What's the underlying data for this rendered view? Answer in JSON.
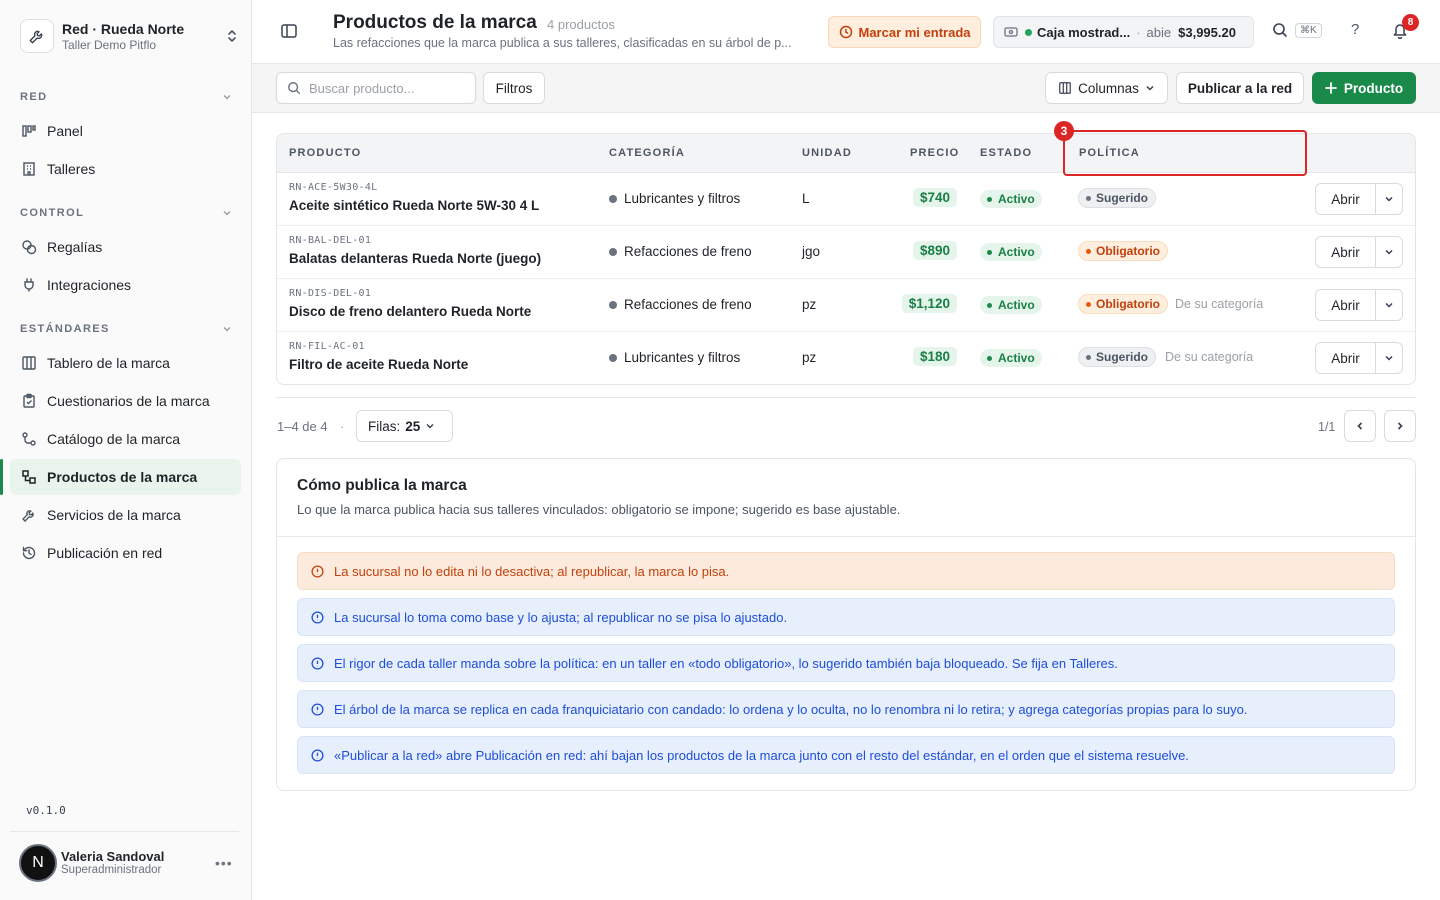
{
  "sidebar": {
    "org_name": "Red · Rueda Norte",
    "org_sub": "Taller Demo Pitflo",
    "sections": [
      {
        "label": "RED",
        "items": [
          {
            "label": "Panel"
          },
          {
            "label": "Talleres"
          }
        ]
      },
      {
        "label": "CONTROL",
        "items": [
          {
            "label": "Regalías"
          },
          {
            "label": "Integraciones"
          }
        ]
      },
      {
        "label": "ESTÁNDARES",
        "items": [
          {
            "label": "Tablero de la marca"
          },
          {
            "label": "Cuestionarios de la marca"
          },
          {
            "label": "Catálogo de la marca"
          },
          {
            "label": "Productos de la marca"
          },
          {
            "label": "Servicios de la marca"
          },
          {
            "label": "Publicación en red"
          }
        ]
      }
    ],
    "version": "v0.1.0",
    "user": {
      "initial": "N",
      "name": "Valeria Sandoval",
      "role": "Superadministrador"
    }
  },
  "header": {
    "title": "Productos de la marca",
    "count": "4 productos",
    "subtitle": "Las refacciones que la marca publica a sus talleres, clasificadas en su árbol de p...",
    "entrada_label": "Marcar mi entrada",
    "caja_name": "Caja mostrad...",
    "caja_sep": "·",
    "caja_status": "abie",
    "caja_amount": "$3,995.20",
    "kbd": "⌘K",
    "help": "?",
    "notifications": "8"
  },
  "toolbar": {
    "search_placeholder": "Buscar producto...",
    "filters_label": "Filtros",
    "columns_label": "Columnas",
    "publish_label": "Publicar a la red",
    "add_label": "Producto"
  },
  "table": {
    "columns": [
      "PRODUCTO",
      "CATEGORÍA",
      "UNIDAD",
      "PRECIO",
      "ESTADO",
      "POLÍTICA"
    ],
    "open_label": "Abrir",
    "rows": [
      {
        "sku": "RN-ACE-5W30-4L",
        "name": "Aceite sintético Rueda Norte 5W-30 4 L",
        "category": "Lubricantes y filtros",
        "unit": "L",
        "price": "$740",
        "status": "Activo",
        "policy": "Sugerido",
        "policy_type": "sug",
        "note": ""
      },
      {
        "sku": "RN-BAL-DEL-01",
        "name": "Balatas delanteras Rueda Norte (juego)",
        "category": "Refacciones de freno",
        "unit": "jgo",
        "price": "$890",
        "status": "Activo",
        "policy": "Obligatorio",
        "policy_type": "obl",
        "note": ""
      },
      {
        "sku": "RN-DIS-DEL-01",
        "name": "Disco de freno delantero Rueda Norte",
        "category": "Refacciones de freno",
        "unit": "pz",
        "price": "$1,120",
        "status": "Activo",
        "policy": "Obligatorio",
        "policy_type": "obl",
        "note": "De su categoría"
      },
      {
        "sku": "RN-FIL-AC-01",
        "name": "Filtro de aceite Rueda Norte",
        "category": "Lubricantes y filtros",
        "unit": "pz",
        "price": "$180",
        "status": "Activo",
        "policy": "Sugerido",
        "policy_type": "sug",
        "note": "De su categoría"
      }
    ]
  },
  "annotation": {
    "badge": "3"
  },
  "pagination": {
    "range": "1–4 de 4",
    "dot": "·",
    "rows_label": "Filas:",
    "rows_value": "25",
    "page": "1/1"
  },
  "info": {
    "title": "Cómo publica la marca",
    "subtitle": "Lo que la marca publica hacia sus talleres vinculados: obligatorio se impone; sugerido es base ajustable.",
    "alerts": [
      {
        "type": "warn",
        "text": "La sucursal no lo edita ni lo desactiva; al republicar, la marca lo pisa."
      },
      {
        "type": "info",
        "text": "La sucursal lo toma como base y lo ajusta; al republicar no se pisa lo ajustado."
      },
      {
        "type": "info",
        "text": "El rigor de cada taller manda sobre la política: en un taller en «todo obligatorio», lo sugerido también baja bloqueado. Se fija en Talleres."
      },
      {
        "type": "info",
        "text": "El árbol de la marca se replica en cada franquiciatario con candado: lo ordena y lo oculta, no lo renombra ni lo retira; y agrega categorías propias para lo suyo."
      },
      {
        "type": "info",
        "text": "«Publicar a la red» abre Publicación en red: ahí bajan los productos de la marca junto con el resto del estándar, en el orden que el sistema resuelve."
      }
    ]
  }
}
